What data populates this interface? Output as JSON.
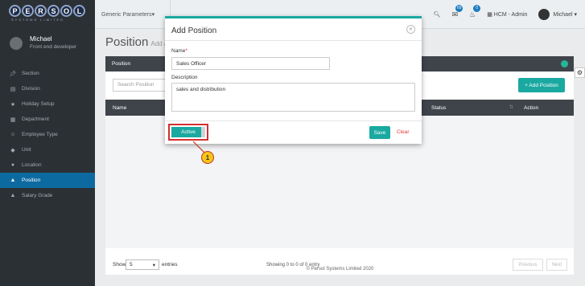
{
  "logo": {
    "text": "PERSOL",
    "subtext": "SYSTEMS LIMITED"
  },
  "profile": {
    "name": "Michael",
    "role": "Front end developer"
  },
  "sidebar": {
    "items": [
      {
        "label": "Section",
        "icon": "pin-icon"
      },
      {
        "label": "Division",
        "icon": "document-icon"
      },
      {
        "label": "Holiday Setup",
        "icon": "star-icon"
      },
      {
        "label": "Department",
        "icon": "building-icon"
      },
      {
        "label": "Employee Type",
        "icon": "users-icon"
      },
      {
        "label": "Unit",
        "icon": "tag-icon"
      },
      {
        "label": "Location",
        "icon": "map-pin-icon"
      },
      {
        "label": "Position",
        "icon": "graduation-cap-icon",
        "active": true
      },
      {
        "label": "Salary Grade",
        "icon": "pin-icon"
      }
    ]
  },
  "topbar": {
    "dropdown": "Generic Parameters",
    "badge1": "69",
    "badge2": "0",
    "app_label": "HCM - Admin",
    "user": "Michael"
  },
  "page": {
    "title": "Position",
    "subtitle": "Add /"
  },
  "panel": {
    "header": "Position",
    "search_placeholder": "Search Position",
    "add_button": "+ Add Position",
    "columns": {
      "name": "Name",
      "status": "Status",
      "action": "Action"
    },
    "show_label": "Show",
    "page_size": "5",
    "entries_label": "entries",
    "showing_text": "Showing 0 to 0 of 0 entry",
    "prev": "Previous",
    "next": "Next"
  },
  "copyright": "© Persol Systems Limited 2020",
  "modal": {
    "title": "Add Position",
    "name_label": "Name",
    "name_required": "*",
    "name_value": "Sales Officer",
    "description_label": "Description",
    "description_value": "sales and distribution",
    "active_label": "Active",
    "save_label": "Save",
    "clear_label": "Clear"
  },
  "callout": {
    "number": "1"
  },
  "colors": {
    "accent": "#1aa9a0",
    "sidebar_bg": "#2b3035",
    "active_nav": "#0d6aa0",
    "highlight": "#d32f2f"
  }
}
